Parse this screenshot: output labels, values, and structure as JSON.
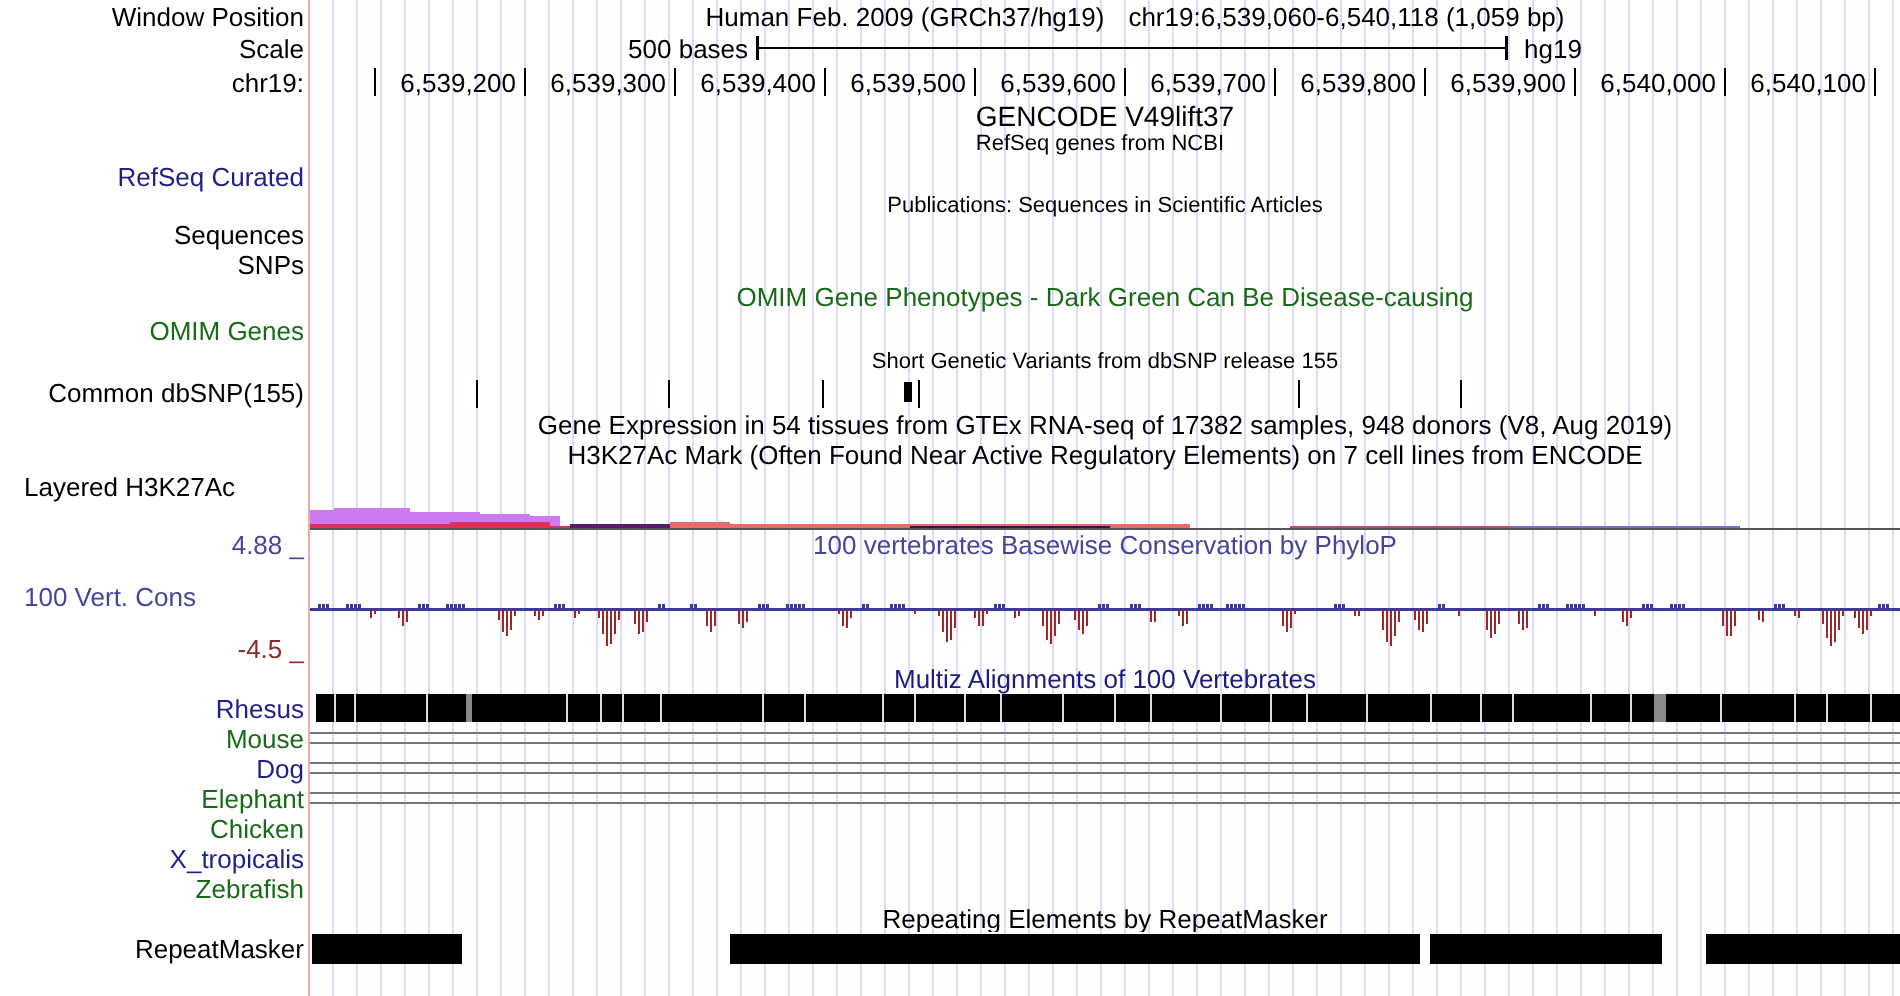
{
  "header": {
    "label": "Window Position",
    "title": "Human Feb. 2009 (GRCh37/hg19)",
    "position": "chr19:6,539,060-6,540,118 (1,059 bp)"
  },
  "scale": {
    "label": "Scale",
    "span": "500 bases",
    "assembly": "hg19"
  },
  "ruler": {
    "label": "chr19:",
    "ticks": [
      "6,539,200",
      "6,539,300",
      "6,539,400",
      "6,539,500",
      "6,539,600",
      "6,539,700",
      "6,539,800",
      "6,539,900",
      "6,540,000",
      "6,540,100"
    ]
  },
  "tracks": [
    {
      "kind": "gene",
      "title": "GENCODE V49lift37",
      "subtitle": "RefSeq genes from NCBI",
      "label": "RefSeq Curated",
      "color": "#1f1f8a"
    },
    {
      "kind": "publications",
      "title": "Publications: Sequences in Scientific Articles",
      "labels": [
        "Sequences",
        "SNPs"
      ]
    },
    {
      "kind": "omim",
      "title": "OMIM Gene Phenotypes - Dark Green Can Be Disease-causing",
      "label": "OMIM Genes",
      "color": "#176b17"
    },
    {
      "kind": "snp",
      "title": "Short Genetic Variants from dbSNP release 155",
      "label": "Common dbSNP(155)",
      "color": "#000000"
    },
    {
      "kind": "gtex",
      "title": "Gene Expression in 54 tissues from GTEx RNA-seq of 17382 samples, 948 donors (V8, Aug 2019)"
    },
    {
      "kind": "h3k27ac",
      "title": "H3K27Ac Mark (Often Found Near Active Regulatory Elements) on 7 cell lines from ENCODE",
      "label": "Layered H3K27Ac",
      "color": "#000000"
    },
    {
      "kind": "phylop",
      "title": "100 vertebrates Basewise Conservation by PhyloP",
      "label": "100 Vert. Cons",
      "color": "#45459a",
      "max": "4.88 _",
      "min": "-4.5 _"
    },
    {
      "kind": "multiz",
      "title": "Multiz Alignments of 100 Vertebrates",
      "species": [
        {
          "name": "Rhesus",
          "color": "#1f1f8a"
        },
        {
          "name": "Mouse",
          "color": "#176b17"
        },
        {
          "name": "Dog",
          "color": "#1f1f8a"
        },
        {
          "name": "Elephant",
          "color": "#176b17"
        },
        {
          "name": "Chicken",
          "color": "#176b17"
        },
        {
          "name": "X_tropicalis",
          "color": "#1f1f8a"
        },
        {
          "name": "Zebrafish",
          "color": "#176b17"
        }
      ]
    },
    {
      "kind": "repeats",
      "title": "Repeating Elements by RepeatMasker",
      "label": "RepeatMasker",
      "color": "#000000"
    }
  ]
}
